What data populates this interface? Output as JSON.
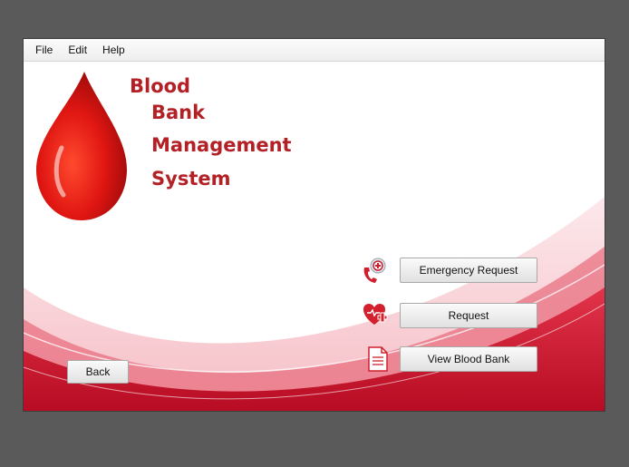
{
  "menubar": {
    "file": "File",
    "edit": "Edit",
    "help": "Help"
  },
  "title": {
    "line1": "Blood",
    "line2": "Bank",
    "line3": "Management",
    "line4": "System"
  },
  "actions": {
    "emergency_label": "Emergency Request",
    "request_label": "Request",
    "view_label": "View Blood Bank"
  },
  "back_label": "Back",
  "icons": {
    "drop": "blood-drop-icon",
    "emergency": "phone-medical-icon",
    "request": "heart-plus-icon",
    "view": "document-icon"
  },
  "colors": {
    "accent": "#b32025",
    "wave": "#c8102e"
  }
}
